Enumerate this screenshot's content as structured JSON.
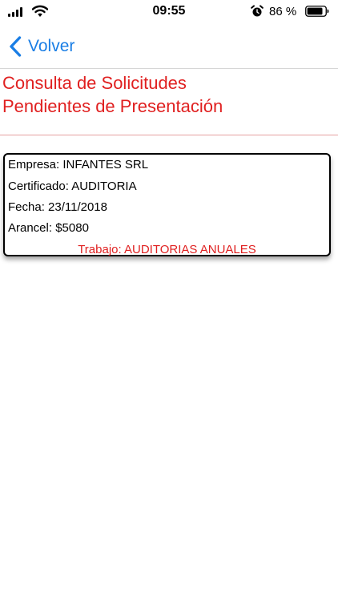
{
  "status_bar": {
    "time": "09:55",
    "battery_percent": "86 %",
    "battery_level": 0.86,
    "icons": [
      "signal-icon",
      "wifi-icon",
      "alarm-icon",
      "battery-icon"
    ]
  },
  "nav": {
    "back_label": "Volver",
    "back_icon": "chevron-left-icon"
  },
  "page": {
    "title_line_1": "Consulta de Solicitudes",
    "title_line_2": "Pendientes de Presentación"
  },
  "request": {
    "empresa": "Empresa: INFANTES SRL",
    "certificado": "Certificado: AUDITORIA",
    "fecha": "Fecha: 23/11/2018",
    "arancel": "Arancel: $5080",
    "trabajo": "Trabajo: AUDITORIAS ANUALES"
  },
  "colors": {
    "accent_red": "#e02020",
    "link_blue": "#1a7ee5"
  }
}
